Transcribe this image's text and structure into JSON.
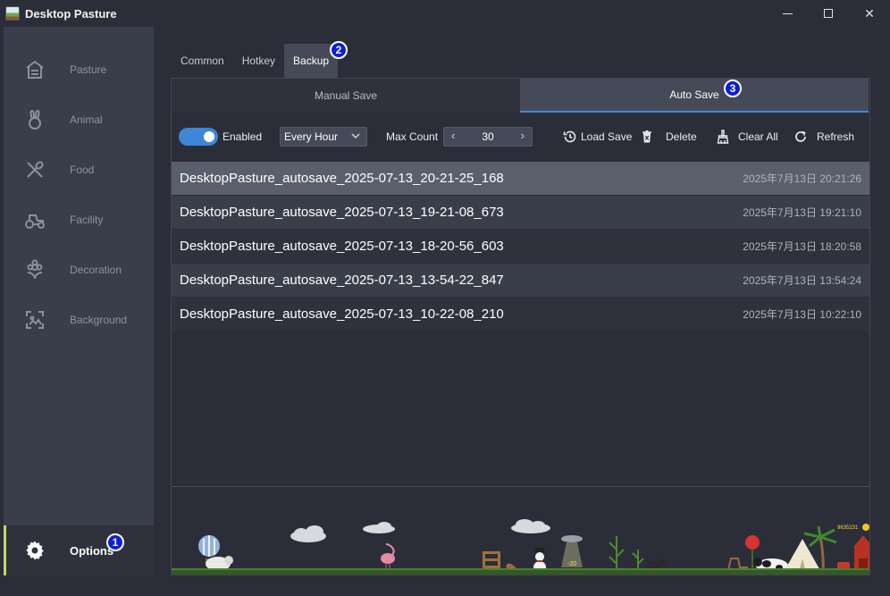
{
  "window": {
    "title": "Desktop Pasture",
    "controls": {
      "minimize": "minimize",
      "maximize": "maximize",
      "close": "✕"
    }
  },
  "sidebar": {
    "items": [
      {
        "label": "Pasture",
        "icon": "barn-icon"
      },
      {
        "label": "Animal",
        "icon": "rabbit-icon"
      },
      {
        "label": "Food",
        "icon": "utensils-icon"
      },
      {
        "label": "Facility",
        "icon": "tractor-icon"
      },
      {
        "label": "Decoration",
        "icon": "flower-icon"
      },
      {
        "label": "Background",
        "icon": "image-frame-icon"
      }
    ],
    "options": {
      "label": "Options",
      "icon": "gear-icon"
    }
  },
  "badges": [
    "1",
    "2",
    "3"
  ],
  "tabs": {
    "common": "Common",
    "hotkey": "Hotkey",
    "backup": "Backup",
    "active": "Backup"
  },
  "subtabs": {
    "manual": "Manual Save",
    "auto": "Auto Save",
    "active": "Auto Save"
  },
  "toolbar": {
    "enabled_label": "Enabled",
    "enabled": true,
    "interval": "Every Hour",
    "max_count_label": "Max Count",
    "max_count": "30",
    "prev": "‹",
    "next": "›",
    "load_save": "Load Save",
    "delete": "Delete",
    "clear_all": "Clear All",
    "refresh": "Refresh"
  },
  "saves": [
    {
      "name": "DesktopPasture_autosave_2025-07-13_20-21-25_168",
      "time": "2025年7月13日 20:21:26",
      "selected": true
    },
    {
      "name": "DesktopPasture_autosave_2025-07-13_19-21-08_673",
      "time": "2025年7月13日 19:21:10"
    },
    {
      "name": "DesktopPasture_autosave_2025-07-13_18-20-56_603",
      "time": "2025年7月13日 18:20:58"
    },
    {
      "name": "DesktopPasture_autosave_2025-07-13_13-54-22_847",
      "time": "2025年7月13日 13:54:24"
    },
    {
      "name": "DesktopPasture_autosave_2025-07-13_10-22-08_210",
      "time": "2025年7月13日 10:22:10"
    }
  ],
  "scene": {
    "coins": "9635231",
    "sign": "-20"
  },
  "colors": {
    "accent": "#3f86d6",
    "badge": "#0b1fd6",
    "options_marker": "#c6d66a"
  }
}
